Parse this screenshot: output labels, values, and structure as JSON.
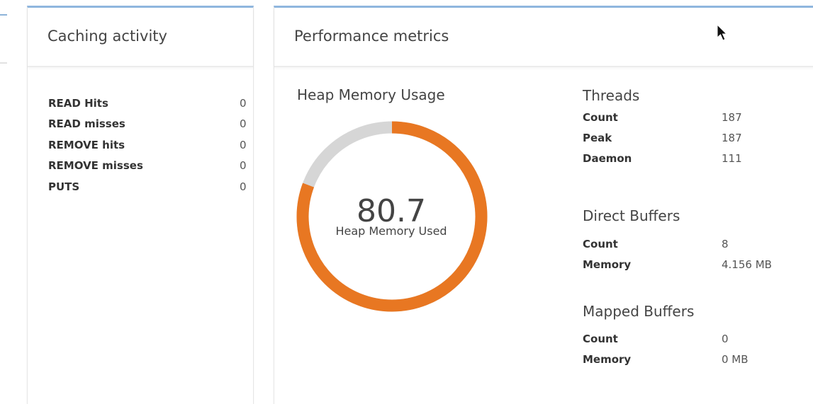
{
  "caching_panel": {
    "title": "Caching activity",
    "rows": [
      {
        "label": "READ Hits",
        "value": "0"
      },
      {
        "label": "READ misses",
        "value": "0"
      },
      {
        "label": "REMOVE hits",
        "value": "0"
      },
      {
        "label": "REMOVE misses",
        "value": "0"
      },
      {
        "label": "PUTS",
        "value": "0"
      }
    ]
  },
  "performance_panel": {
    "title": "Performance metrics",
    "heap": {
      "title": "Heap Memory Usage",
      "value": "80.7",
      "caption": "Heap Memory Used",
      "used_percent": 80.7,
      "used_color": "#e87722",
      "free_color": "#d6d6d6"
    },
    "threads": {
      "title": "Threads",
      "rows": [
        {
          "label": "Count",
          "value": "187"
        },
        {
          "label": "Peak",
          "value": "187"
        },
        {
          "label": "Daemon",
          "value": "111"
        }
      ]
    },
    "direct_buffers": {
      "title": "Direct Buffers",
      "rows": [
        {
          "label": "Count",
          "value": "8"
        },
        {
          "label": "Memory",
          "value": "4.156 MB"
        }
      ]
    },
    "mapped_buffers": {
      "title": "Mapped Buffers",
      "rows": [
        {
          "label": "Count",
          "value": "0"
        },
        {
          "label": "Memory",
          "value": "0 MB"
        }
      ]
    }
  },
  "colors": {
    "panel_accent": "#8fb6de",
    "gauge_used": "#e87722",
    "gauge_free": "#d6d6d6"
  },
  "icons": {
    "cursor": "mouse-pointer-icon"
  }
}
